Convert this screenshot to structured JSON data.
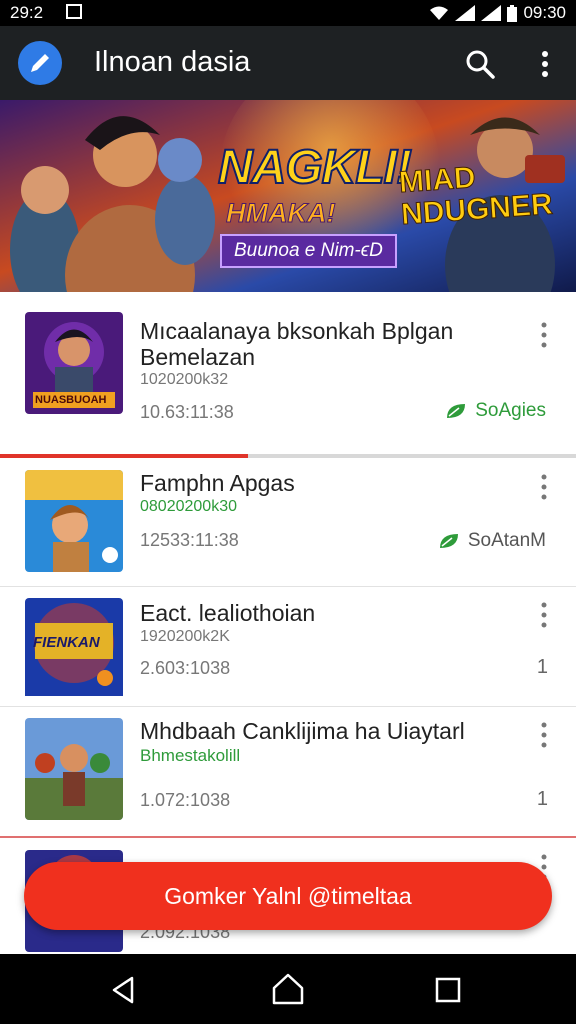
{
  "status_bar": {
    "time_left": "29:2",
    "time_right": "09:30"
  },
  "app_bar": {
    "title": "Ilnoan dasia",
    "logo_icon": "pencil-icon",
    "search_icon": "search-icon",
    "menu_icon": "more-vert-icon"
  },
  "banner": {
    "title_left": "NAGKLI!",
    "subtitle_left": "HMAKA!",
    "tag": "Buunoa e Nim-ϵD",
    "title_right_line1": "MIAD",
    "title_right_line2": "NDUGNER"
  },
  "items": [
    {
      "title": "Mıcaalanaya bksonkah Bplgan Bemelazan",
      "subtitle": "1020200k32",
      "time": "10.63:11:38",
      "action": "SoAgies",
      "action_icon": "leaf-icon",
      "thumb_text": "NUASBUOAH"
    },
    {
      "title": "Famphn Apgas",
      "subtitle": "08020200k30",
      "time": "12533:11:38",
      "action": "SoAtanM",
      "action_icon": "leaf-icon"
    },
    {
      "title": "Eact. lealiothoian",
      "subtitle": "1920200k2K",
      "time": "2.603:1038",
      "count": "1",
      "thumb_text": "FIENKAN"
    },
    {
      "title": "Mhdbaah Canklijima ha Uiaytarl",
      "subtitle": "Bhmestakolill",
      "time": "1.072:1038",
      "count": "1"
    },
    {
      "time": "2.092:1038"
    }
  ],
  "progress": {
    "value": 0.43,
    "fill_color": "#e0342a"
  },
  "fab": {
    "label": "Gomker Yalnl @timeltaa",
    "color": "#f0301e"
  },
  "nav": {
    "back_icon": "back-icon",
    "home_icon": "home-icon",
    "recent_icon": "recent-apps-icon"
  }
}
